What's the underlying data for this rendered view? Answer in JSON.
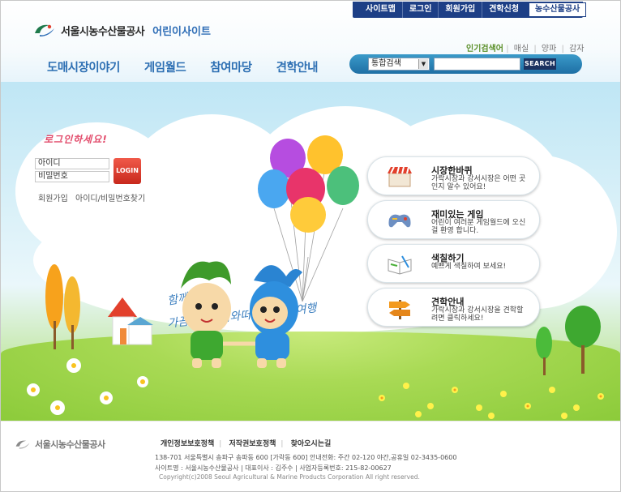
{
  "util_nav": [
    "사이트맵",
    "로그인",
    "회원가입",
    "견학신청"
  ],
  "util_highlight": "농수산물공사",
  "logo": {
    "name": "서울시농수산물공사",
    "sub": "어린이사이트"
  },
  "popular": {
    "label": "인기검색어",
    "keywords": [
      "매실",
      "양파",
      "감자"
    ]
  },
  "gnb": [
    "도매시장이야기",
    "게임월드",
    "참여마당",
    "견학안내"
  ],
  "search": {
    "select_value": "통합검색",
    "button": "SEARCH"
  },
  "login": {
    "title": "로그인하세요!",
    "id_placeholder": "아이디",
    "pw_placeholder": "비밀번호",
    "button": "LOGIN",
    "join": "회원가입",
    "find": "아이디/비밀번호찾기"
  },
  "tagline": {
    "line1": "함께가요!",
    "line2": "가끔이나끔이와떠나는 시장여행"
  },
  "cards": [
    {
      "title": "시장한바퀴",
      "desc": "가락시장과 강서시장은 어떤 곳인지 알수 있어요!"
    },
    {
      "title": "재미있는 게임",
      "desc": "어린이 여러분 게임월드에 오신걸 환영 합니다."
    },
    {
      "title": "색칠하기",
      "desc": "예쁘게 색칠하여 보세요!"
    },
    {
      "title": "견학안내",
      "desc": "가락시장과 강서시장을 견학할려면 클릭하세요!"
    }
  ],
  "footer": {
    "logo": "서울시농수산물공사",
    "links": [
      "개인정보보호정책",
      "저작권보호정책",
      "찾아오시는길"
    ],
    "address": "138-701 서울특별시 송파구 송파동 600 [가락동 600] 안내전화: 주간 02-120 야간,공휴일 02-3435-0600",
    "company": "사이트명 : 서울시농수산물공사  |  대표이사 : 김주수  |  사업자등록번호: 215-82-00627",
    "copyright": "Copyright(c)2008 Seoul Agricultural & Marine Products Corporation All right reserved."
  },
  "colors": {
    "nav_blue": "#1d3f86",
    "gnb_text": "#2d6fb3",
    "login_red": "#e24a6a"
  }
}
